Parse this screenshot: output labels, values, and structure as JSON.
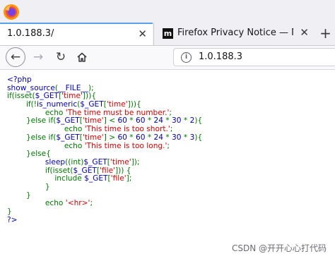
{
  "browser": {
    "tabs": [
      {
        "title": "1.0.188.3/",
        "close": "✕"
      },
      {
        "title": "Firefox Privacy Notice — Mo",
        "favicon": "m",
        "close": "✕"
      }
    ],
    "new_tab": "+",
    "url": "1.0.188.3",
    "accent_color": "#5aa0e6"
  },
  "colors": {
    "keyword": "#007700",
    "default": "#0000bb",
    "string": "#dd0000"
  },
  "source_lines": [
    [
      [
        "df",
        "<?php"
      ]
    ],
    [
      [
        "df",
        "show_source"
      ],
      [
        "kw",
        "("
      ],
      [
        "df",
        "__FILE__"
      ],
      [
        "kw",
        ");"
      ]
    ],
    [
      [
        "kw",
        "if(isset("
      ],
      [
        "df",
        "$_GET"
      ],
      [
        "kw",
        "["
      ],
      [
        "st",
        "'time'"
      ],
      [
        "kw",
        "])){"
      ]
    ],
    [
      [
        "kw",
        "        if(!"
      ],
      [
        "df",
        "is_numeric"
      ],
      [
        "kw",
        "("
      ],
      [
        "df",
        "$_GET"
      ],
      [
        "kw",
        "["
      ],
      [
        "st",
        "'time'"
      ],
      [
        "kw",
        "])){"
      ]
    ],
    [
      [
        "kw",
        "                echo "
      ],
      [
        "st",
        "'The time must be number.'"
      ],
      [
        "kw",
        ";"
      ]
    ],
    [
      [
        "kw",
        "        }else if("
      ],
      [
        "df",
        "$_GET"
      ],
      [
        "kw",
        "["
      ],
      [
        "st",
        "'time'"
      ],
      [
        "kw",
        "] < "
      ],
      [
        "df",
        "60 "
      ],
      [
        "kw",
        "* "
      ],
      [
        "df",
        "60 "
      ],
      [
        "kw",
        "* "
      ],
      [
        "df",
        "24 "
      ],
      [
        "kw",
        "* "
      ],
      [
        "df",
        "30 "
      ],
      [
        "kw",
        "* "
      ],
      [
        "df",
        "2"
      ],
      [
        "kw",
        "){"
      ]
    ],
    [
      [
        "kw",
        "                        echo "
      ],
      [
        "st",
        "'This time is too short.'"
      ],
      [
        "kw",
        ";"
      ]
    ],
    [
      [
        "kw",
        "        }else if("
      ],
      [
        "df",
        "$_GET"
      ],
      [
        "kw",
        "["
      ],
      [
        "st",
        "'time'"
      ],
      [
        "kw",
        "] > "
      ],
      [
        "df",
        "60 "
      ],
      [
        "kw",
        "* "
      ],
      [
        "df",
        "60 "
      ],
      [
        "kw",
        "* "
      ],
      [
        "df",
        "24 "
      ],
      [
        "kw",
        "* "
      ],
      [
        "df",
        "30 "
      ],
      [
        "kw",
        "* "
      ],
      [
        "df",
        "3"
      ],
      [
        "kw",
        "){"
      ]
    ],
    [
      [
        "kw",
        "                        echo "
      ],
      [
        "st",
        "'This time is too long.'"
      ],
      [
        "kw",
        ";"
      ]
    ],
    [
      [
        "kw",
        "        }else{"
      ]
    ],
    [
      [
        "kw",
        "                "
      ],
      [
        "df",
        "sleep"
      ],
      [
        "kw",
        "((int)"
      ],
      [
        "df",
        "$_GET"
      ],
      [
        "kw",
        "["
      ],
      [
        "st",
        "'time'"
      ],
      [
        "kw",
        "]);"
      ]
    ],
    [
      [
        "kw",
        "                if(isset("
      ],
      [
        "df",
        "$_GET"
      ],
      [
        "kw",
        "["
      ],
      [
        "st",
        "'file'"
      ],
      [
        "kw",
        "])) {"
      ]
    ],
    [
      [
        "kw",
        "                    include "
      ],
      [
        "df",
        "$_GET"
      ],
      [
        "kw",
        "["
      ],
      [
        "st",
        "'file'"
      ],
      [
        "kw",
        "];"
      ]
    ],
    [
      [
        "kw",
        "                }"
      ]
    ],
    [
      [
        "kw",
        "        }"
      ]
    ],
    [
      [
        "kw",
        "                echo "
      ],
      [
        "st",
        "'<hr>'"
      ],
      [
        "kw",
        ";"
      ]
    ],
    [
      [
        "kw",
        "}"
      ]
    ],
    [
      [
        "df",
        "?>"
      ]
    ]
  ],
  "watermark": "CSDN @开开心心打代码"
}
